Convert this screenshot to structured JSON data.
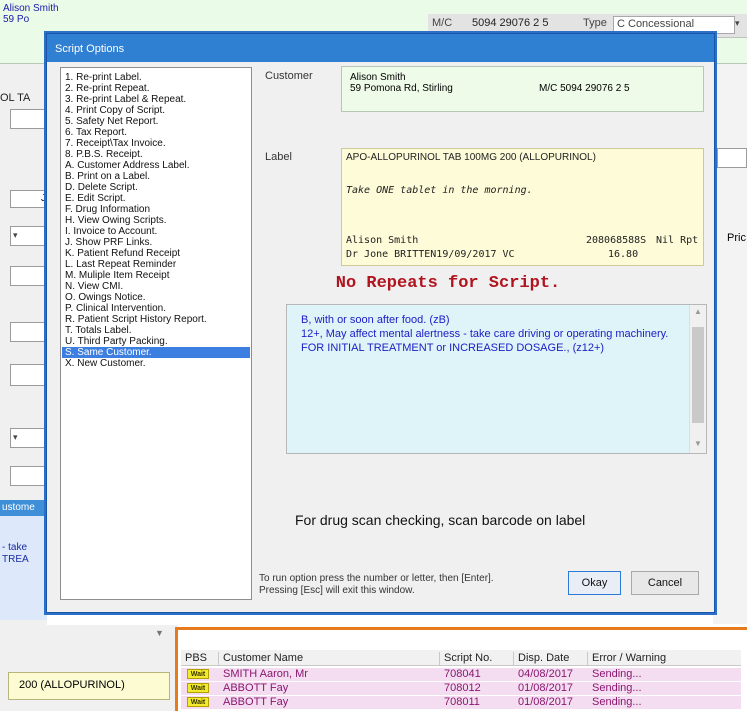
{
  "background": {
    "patient_name": "Alison Smith",
    "patient_addr_partial": "59 Po",
    "mc_label": "M/C",
    "mc_value": "5094 29076 2 5",
    "type_label": "Type",
    "type_value": "C Concessional",
    "left_tab": "OL TA",
    "left_letter_j": "J",
    "right_price": "Pric",
    "left_customer_head": "ustome",
    "left_customer_text": "- take\nTREA",
    "bottom_field": "200 (ALLOPURINOL)"
  },
  "dialog": {
    "title": "Script Options",
    "options": [
      "1. Re-print Label.",
      "2. Re-print Repeat.",
      "3. Re-print Label & Repeat.",
      "4. Print Copy of Script.",
      "5. Safety Net Report.",
      "6. Tax Report.",
      "7. Receipt\\Tax Invoice.",
      "8. P.B.S. Receipt.",
      "A. Customer Address Label.",
      "B. Print on a Label.",
      "D. Delete Script.",
      "E. Edit Script.",
      "F. Drug Information",
      "H. View Owing Scripts.",
      "I. Invoice to Account.",
      "J. Show PRF Links.",
      "K. Patient Refund Receipt",
      "L. Last Repeat Reminder",
      "M. Muliple Item Receipt",
      "N. View CMI.",
      "O. Owings Notice.",
      "P. Clinical Intervention.",
      "R. Patient Script History Report.",
      "T. Totals Label.",
      "U. Third Party Packing.",
      "S. Same Customer.",
      "X. New Customer."
    ],
    "selected_option": "S. Same Customer.",
    "customer_label": "Customer",
    "customer_name": "Alison Smith",
    "customer_address": "59 Pomona Rd, Stirling",
    "customer_mc": "M/C 5094 29076 2 5",
    "label_label": "Label",
    "label_drug": "APO-ALLOPURINOL TAB 100MG 200 (ALLOPURINOL)",
    "label_directions": "Take ONE tablet in the morning.",
    "label_patient": "Alison Smith",
    "label_script_no": "208068588S",
    "label_repeats": "Nil Rpt",
    "label_doctor_line": "Dr Jone BRITTEN19/09/2017 VC",
    "label_price": "16.80",
    "no_repeats": "No Repeats for Script.",
    "warnings": [
      "B,   with or soon after food. (zB)",
      "12+,   May affect mental alertness - take care driving or operating machinery. FOR INITIAL TREATMENT or INCREASED DOSAGE., (z12+)"
    ],
    "scan_message": "For drug scan checking, scan barcode on label",
    "footer_hint": "To run option press the number or letter, then [Enter].\nPressing [Esc] will exit this window.",
    "okay_label": "Okay",
    "cancel_label": "Cancel"
  },
  "queue": {
    "columns": [
      "PBS",
      "Customer Name",
      "Script No.",
      "Disp. Date",
      "Error / Warning"
    ],
    "rows": [
      {
        "badge": "Wait",
        "name": "SMITH Aaron, Mr",
        "script": "708041",
        "date": "04/08/2017",
        "status": "Sending..."
      },
      {
        "badge": "Wait",
        "name": "ABBOTT Fay",
        "script": "708012",
        "date": "01/08/2017",
        "status": "Sending..."
      },
      {
        "badge": "Wait",
        "name": "ABBOTT Fay",
        "script": "708011",
        "date": "01/08/2017",
        "status": "Sending..."
      }
    ]
  },
  "colors": {
    "title_bar": "#2f7fd3",
    "selection": "#3d7fe0",
    "queue_border": "#e87a1e",
    "no_repeats": "#b0141f",
    "warning_text": "#1d20c6"
  }
}
